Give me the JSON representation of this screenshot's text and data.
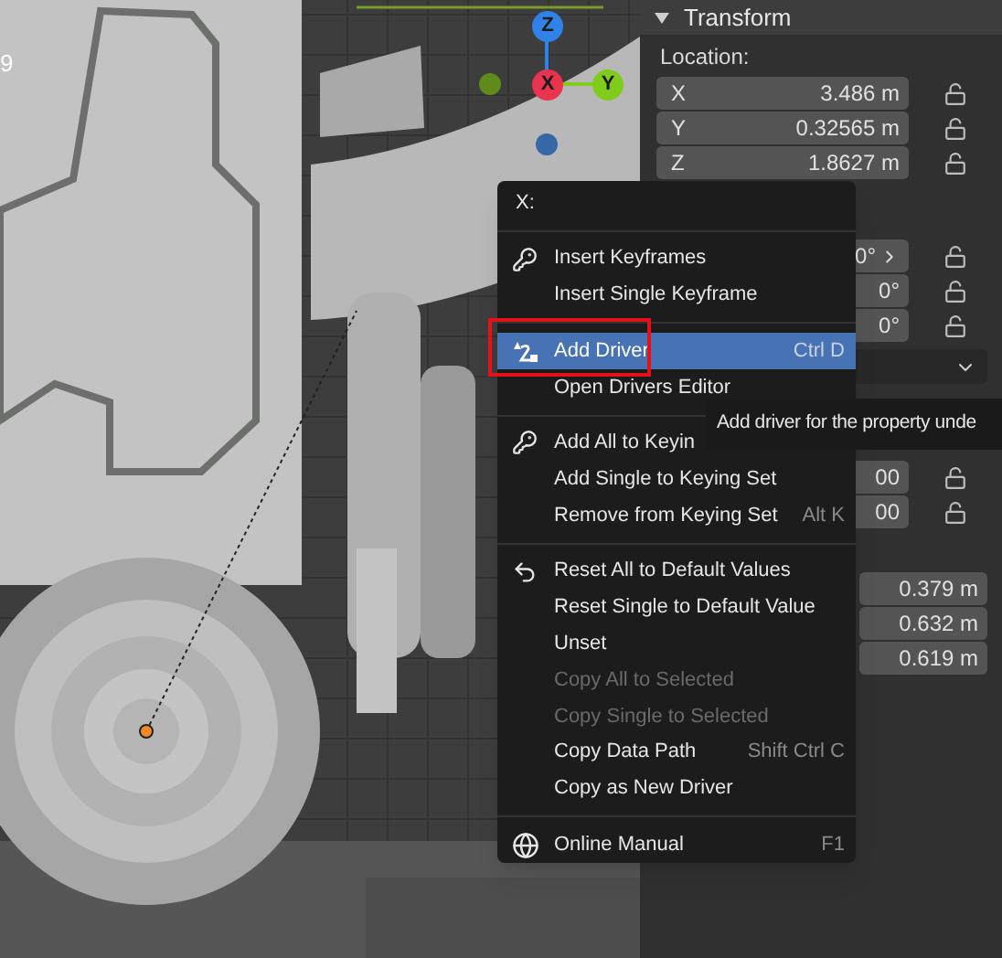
{
  "viewport": {
    "edge_text": "9",
    "gizmo": [
      {
        "label": "Z",
        "color": "#2f83e6"
      },
      {
        "label": "X",
        "color": "#e8344e"
      },
      {
        "label": "Y",
        "color": "#80cc1d"
      }
    ]
  },
  "panel": {
    "title": "Transform",
    "location": {
      "label": "Location:",
      "rows": [
        {
          "axis": "X",
          "value": "3.486 m"
        },
        {
          "axis": "Y",
          "value": "0.32565 m"
        },
        {
          "axis": "Z",
          "value": "1.8627 m"
        }
      ]
    },
    "rotation_values": [
      "0°",
      "0°",
      "0°"
    ],
    "scale_values": [
      "00",
      "00"
    ],
    "dimension_values": [
      "0.379 m",
      "0.632 m",
      "0.619 m"
    ]
  },
  "context_menu": {
    "title": "X:",
    "items": [
      {
        "kind": "separator"
      },
      {
        "kind": "item",
        "label": "Insert Keyframes",
        "selected": false,
        "disabled": false
      },
      {
        "kind": "item",
        "label": "Insert Single Keyframe",
        "selected": false,
        "disabled": false
      },
      {
        "kind": "separator"
      },
      {
        "kind": "item",
        "label": "Add Driver",
        "shortcut": "Ctrl D",
        "selected": true,
        "disabled": false
      },
      {
        "kind": "item",
        "label": "Open Drivers Editor",
        "selected": false,
        "disabled": false
      },
      {
        "kind": "separator"
      },
      {
        "kind": "item",
        "label": "Add All to Keyin",
        "selected": false,
        "disabled": false
      },
      {
        "kind": "item",
        "label": "Add Single to Keying Set",
        "selected": false,
        "disabled": false
      },
      {
        "kind": "item",
        "label": "Remove from Keying Set",
        "shortcut": "Alt K",
        "selected": false,
        "disabled": false
      },
      {
        "kind": "separator"
      },
      {
        "kind": "item",
        "label": "Reset All to Default Values",
        "selected": false,
        "disabled": false
      },
      {
        "kind": "item",
        "label": "Reset Single to Default Value",
        "selected": false,
        "disabled": false
      },
      {
        "kind": "item",
        "label": "Unset",
        "selected": false,
        "disabled": false
      },
      {
        "kind": "item",
        "label": "Copy All to Selected",
        "selected": false,
        "disabled": true
      },
      {
        "kind": "item",
        "label": "Copy Single to Selected",
        "selected": false,
        "disabled": true
      },
      {
        "kind": "item",
        "label": "Copy Data Path",
        "shortcut": "Shift Ctrl C",
        "selected": false,
        "disabled": false
      },
      {
        "kind": "item",
        "label": "Copy as New Driver",
        "selected": false,
        "disabled": false
      },
      {
        "kind": "separator"
      },
      {
        "kind": "item",
        "label": "Online Manual",
        "shortcut": "F1",
        "selected": false,
        "disabled": false
      }
    ]
  },
  "tooltip": {
    "text": "Add driver for the property unde"
  }
}
